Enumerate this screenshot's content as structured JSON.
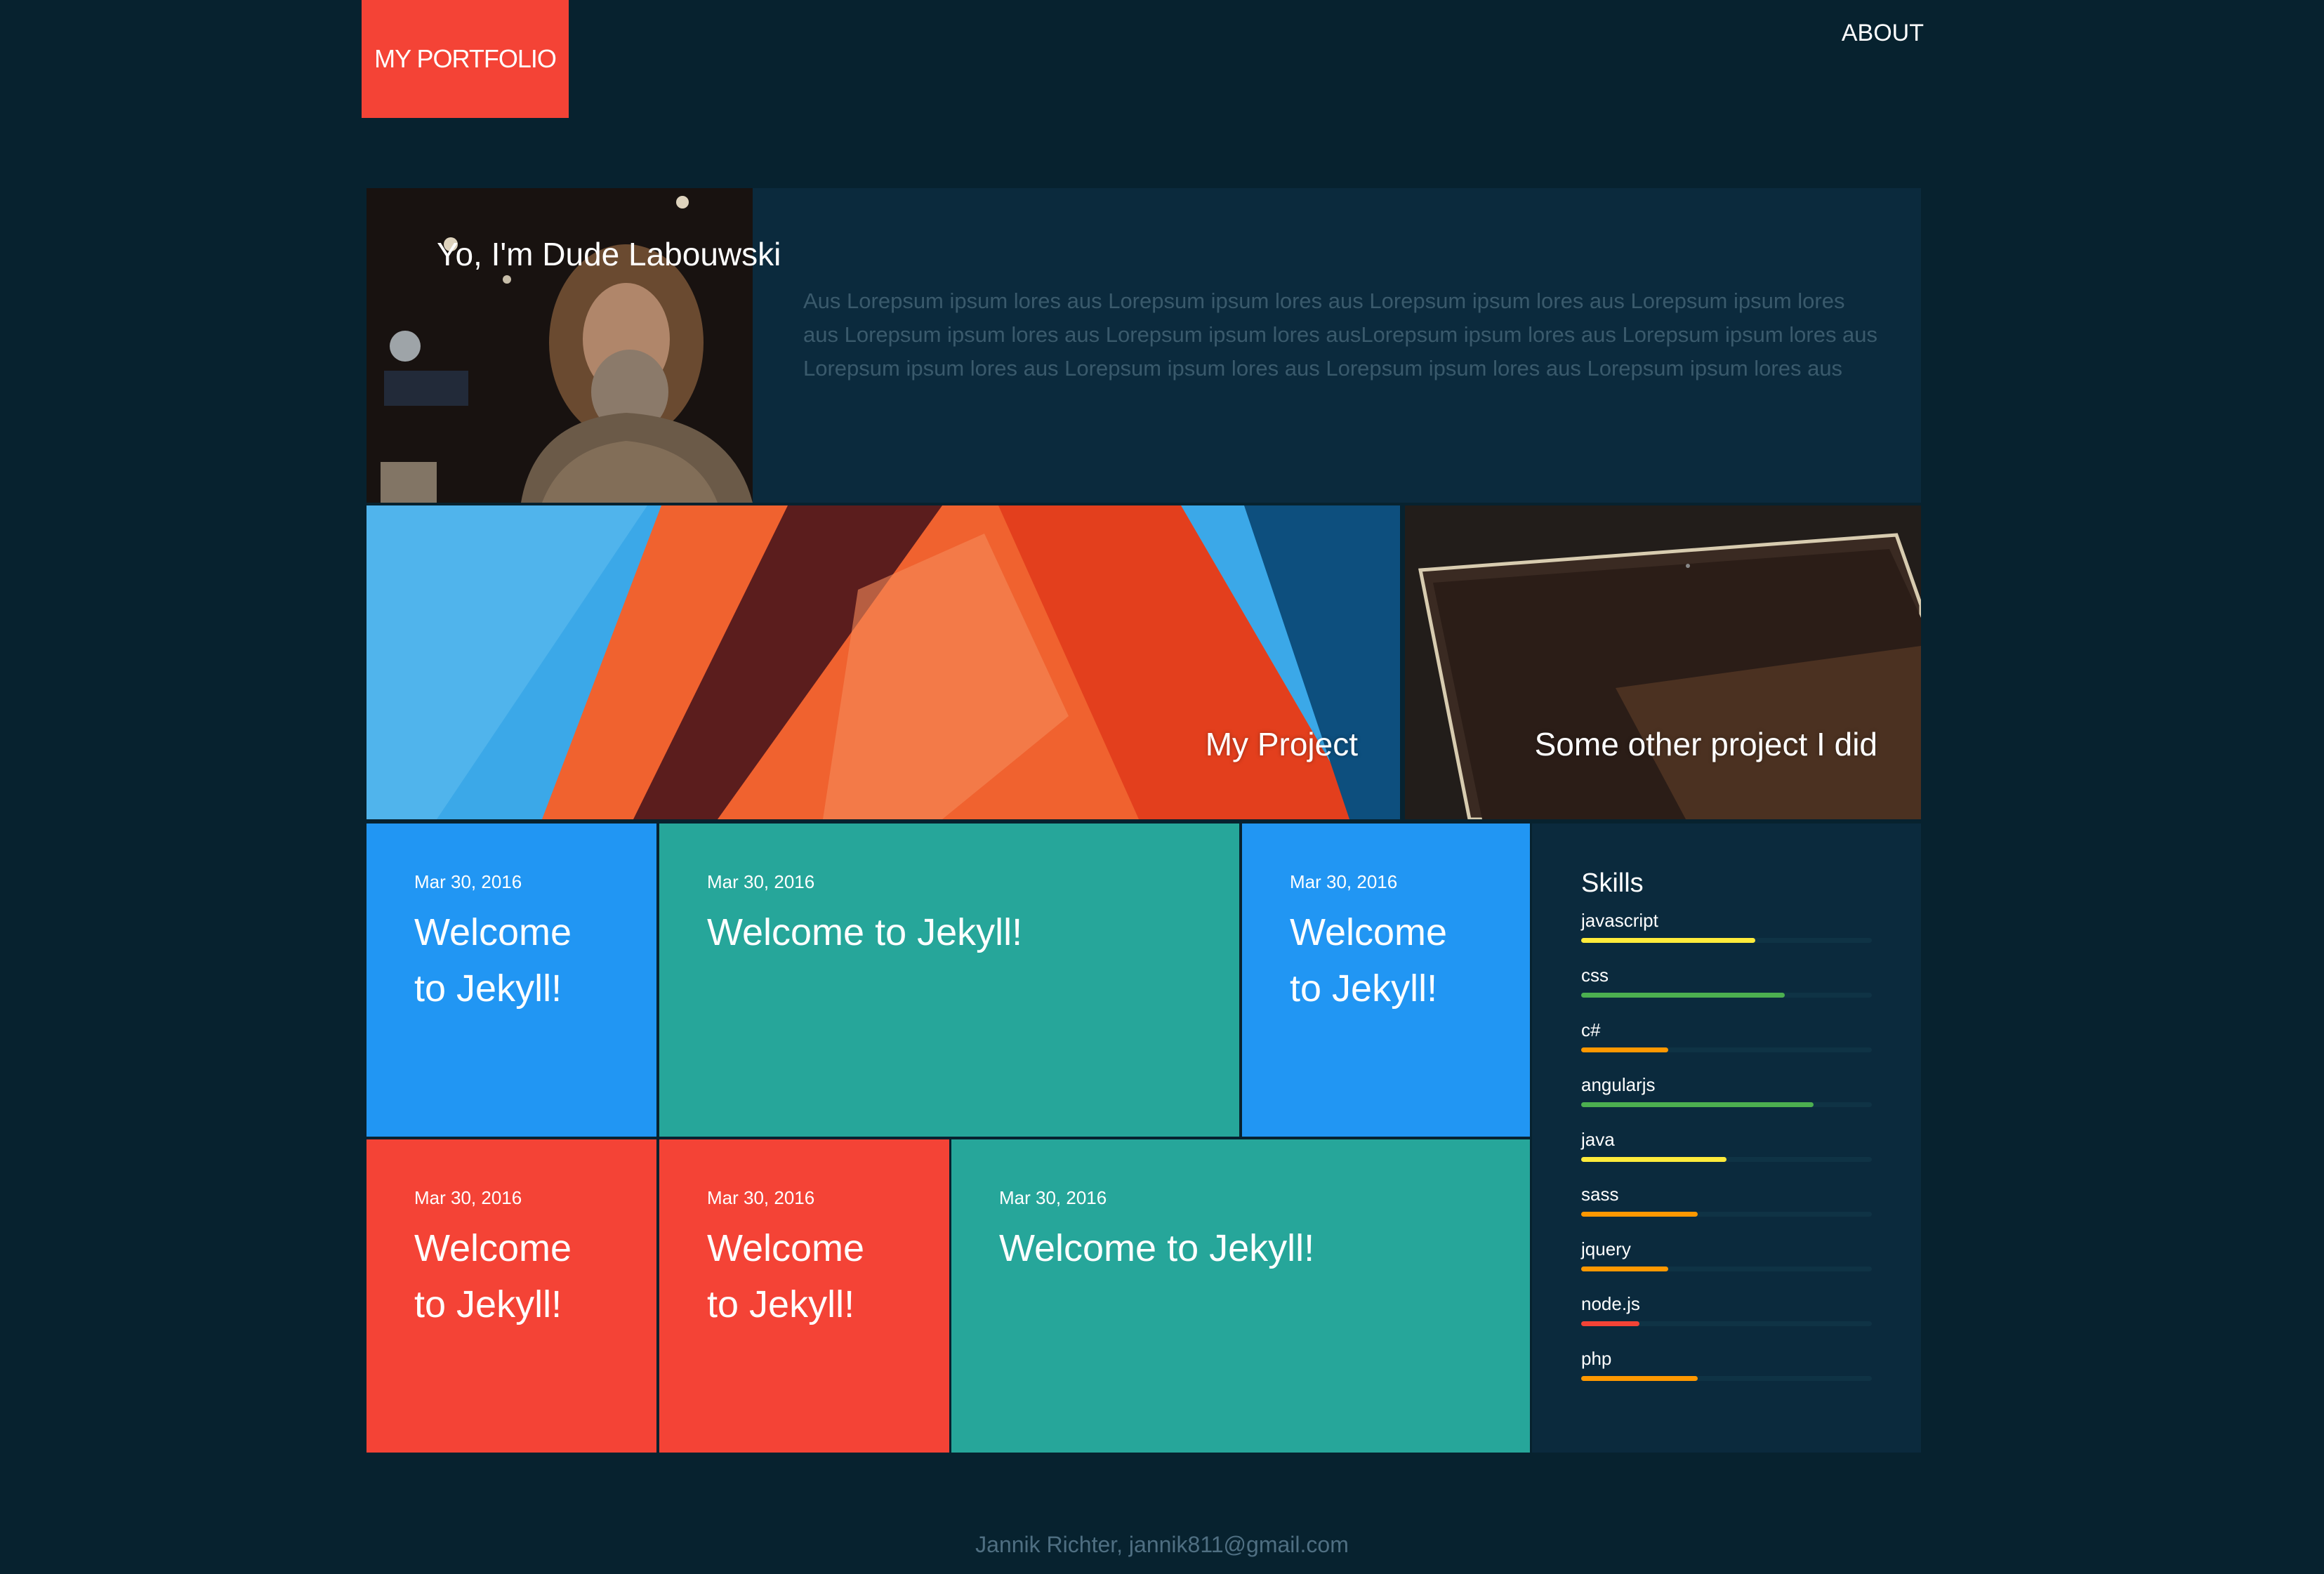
{
  "header": {
    "logo": "MY PORTFOLIO",
    "nav": {
      "about": "ABOUT"
    }
  },
  "profile": {
    "name": "Yo, I'm Dude Labouwski",
    "bio": "Aus Lorepsum ipsum lores aus Lorepsum ipsum lores aus Lorepsum ipsum lores aus Lorepsum ipsum lores aus Lorepsum ipsum lores aus Lorepsum ipsum lores ausLorepsum ipsum lores aus Lorepsum ipsum lores aus Lorepsum ipsum lores aus Lorepsum ipsum lores aus Lorepsum ipsum lores aus Lorepsum ipsum lores aus"
  },
  "projects": [
    {
      "label": "My Project"
    },
    {
      "label": "Some other project I did"
    }
  ],
  "posts": [
    {
      "date": "Mar 30, 2016",
      "title": "Welcome to Jekyll!",
      "color": "blue"
    },
    {
      "date": "Mar 30, 2016",
      "title": "Welcome to Jekyll!",
      "color": "teal"
    },
    {
      "date": "Mar 30, 2016",
      "title": "Welcome to Jekyll!",
      "color": "blue"
    },
    {
      "date": "Mar 30, 2016",
      "title": "Welcome to Jekyll!",
      "color": "red"
    },
    {
      "date": "Mar 30, 2016",
      "title": "Welcome to Jekyll!",
      "color": "red"
    },
    {
      "date": "Mar 30, 2016",
      "title": "Welcome to Jekyll!",
      "color": "teal"
    }
  ],
  "skills": {
    "title": "Skills",
    "items": [
      {
        "name": "javascript",
        "level": 0.6,
        "color": "#ffeb3b"
      },
      {
        "name": "css",
        "level": 0.7,
        "color": "#4caf50"
      },
      {
        "name": "c#",
        "level": 0.3,
        "color": "#ff9800"
      },
      {
        "name": "angularjs",
        "level": 0.8,
        "color": "#4caf50"
      },
      {
        "name": "java",
        "level": 0.5,
        "color": "#ffeb3b"
      },
      {
        "name": "sass",
        "level": 0.4,
        "color": "#ff9800"
      },
      {
        "name": "jquery",
        "level": 0.3,
        "color": "#ff9800"
      },
      {
        "name": "node.js",
        "level": 0.2,
        "color": "#f44336"
      },
      {
        "name": "php",
        "level": 0.4,
        "color": "#ff9800"
      }
    ]
  },
  "footer": {
    "text": "Jannik Richter, jannik811@gmail.com"
  },
  "colors": {
    "background": "#07222f",
    "panel": "#0b2a3d",
    "accent_red": "#f44336",
    "blue": "#2196f3",
    "teal": "#26a69a"
  }
}
